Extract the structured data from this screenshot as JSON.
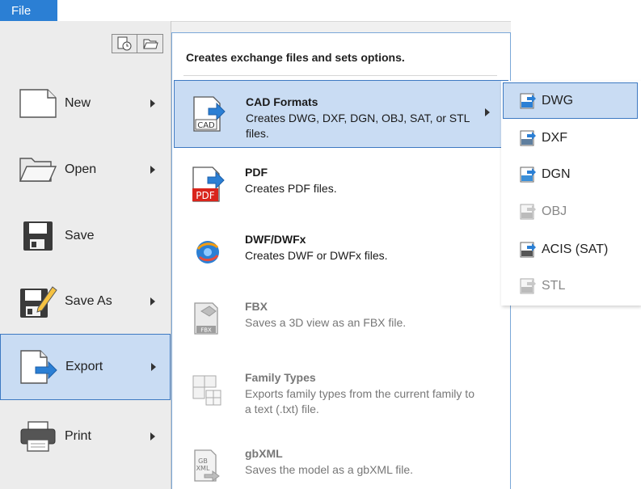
{
  "file_tab": {
    "label": "File"
  },
  "left_menu": {
    "items": [
      {
        "label": "New"
      },
      {
        "label": "Open"
      },
      {
        "label": "Save"
      },
      {
        "label": "Save As"
      },
      {
        "label": "Export"
      },
      {
        "label": "Print"
      }
    ],
    "active": "Export"
  },
  "export_menu": {
    "header": "Creates exchange files and sets options.",
    "items": [
      {
        "title": "CAD Formats",
        "desc": "Creates DWG, DXF, DGN, OBJ, SAT, or STL files.",
        "icon_text": "CAD",
        "state": "active",
        "has_submenu": true
      },
      {
        "title": "PDF",
        "desc": "Creates PDF files.",
        "icon_text": "PDF",
        "state": "enabled"
      },
      {
        "title": "DWF/DWFx",
        "desc": "Creates DWF or DWFx files.",
        "icon_text": "",
        "state": "enabled"
      },
      {
        "title": "FBX",
        "desc": "Saves a 3D view as an FBX file.",
        "icon_text": "FBX",
        "state": "disabled"
      },
      {
        "title": "Family Types",
        "desc": "Exports family types from the current family to a text (.txt) file.",
        "icon_text": "",
        "state": "disabled"
      },
      {
        "title": "gbXML",
        "desc": "Saves the model as a gbXML file.",
        "icon_text": "GB XML",
        "state": "disabled"
      }
    ]
  },
  "cad_formats_menu": {
    "items": [
      {
        "label": "DWG",
        "state": "active"
      },
      {
        "label": "DXF",
        "state": "enabled"
      },
      {
        "label": "DGN",
        "state": "enabled"
      },
      {
        "label": "OBJ",
        "state": "disabled"
      },
      {
        "label": "ACIS (SAT)",
        "state": "enabled"
      },
      {
        "label": "STL",
        "state": "disabled"
      }
    ]
  },
  "colors": {
    "accent": "#2b7fd4",
    "highlight_bg": "#c9dcf3",
    "highlight_border": "#3d79c2",
    "disabled_text": "#777777"
  }
}
